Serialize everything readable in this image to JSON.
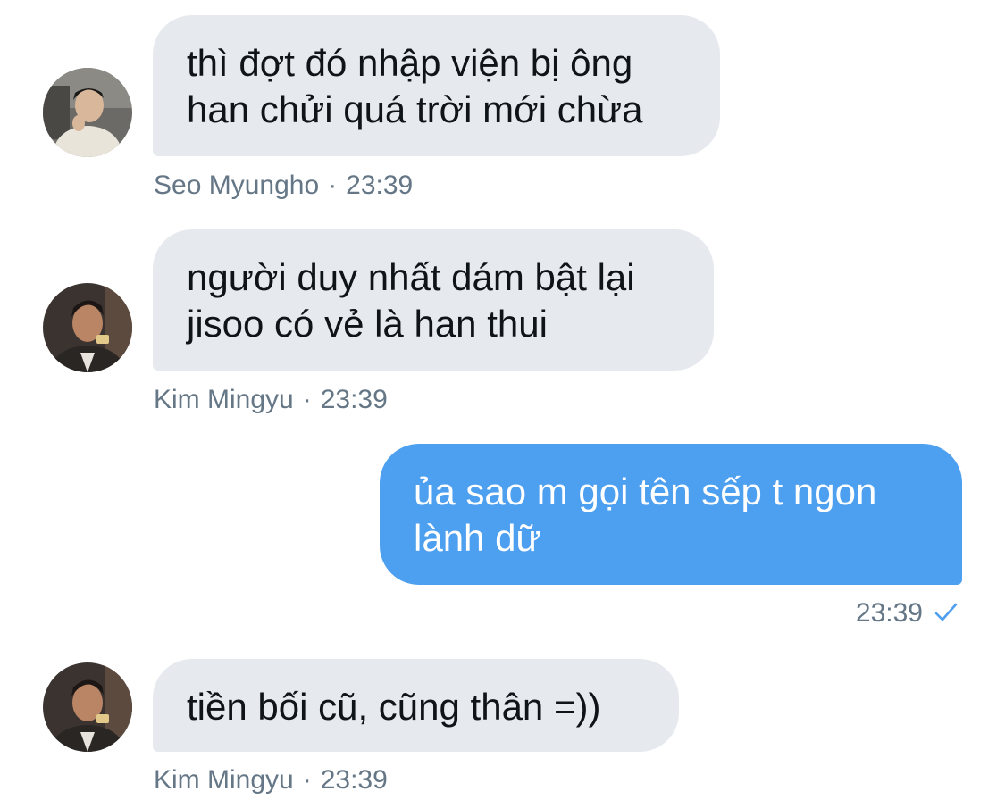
{
  "conversation": {
    "messages": [
      {
        "direction": "received",
        "avatar_icon": "user-avatar-icon",
        "text_line1": "thì đợt đó nhập viện bị ông",
        "text_line2": "han chửi quá trời mới chừa",
        "sender": "Seo Myungho",
        "separator": "·",
        "time": "23:39"
      },
      {
        "direction": "received",
        "avatar_icon": "user-avatar-icon",
        "text_line1": "người duy nhất dám bật lại",
        "text_line2": "jisoo có vẻ là han thui",
        "sender": "Kim Mingyu",
        "separator": "·",
        "time": "23:39"
      },
      {
        "direction": "sent",
        "text_line1": "ủa sao m gọi tên sếp t ngon",
        "text_line2": "lành dữ",
        "time": "23:39",
        "status_icon": "checkmark-icon"
      },
      {
        "direction": "received",
        "avatar_icon": "user-avatar-icon",
        "text_line1": "tiền bối cũ, cũng thân =))",
        "sender": "Kim Mingyu",
        "separator": "·",
        "time": "23:39"
      }
    ]
  },
  "colors": {
    "received_bubble": "#e6e9ee",
    "sent_bubble": "#4d9ff0",
    "meta_text": "#657786",
    "check": "#4d9ff0"
  }
}
